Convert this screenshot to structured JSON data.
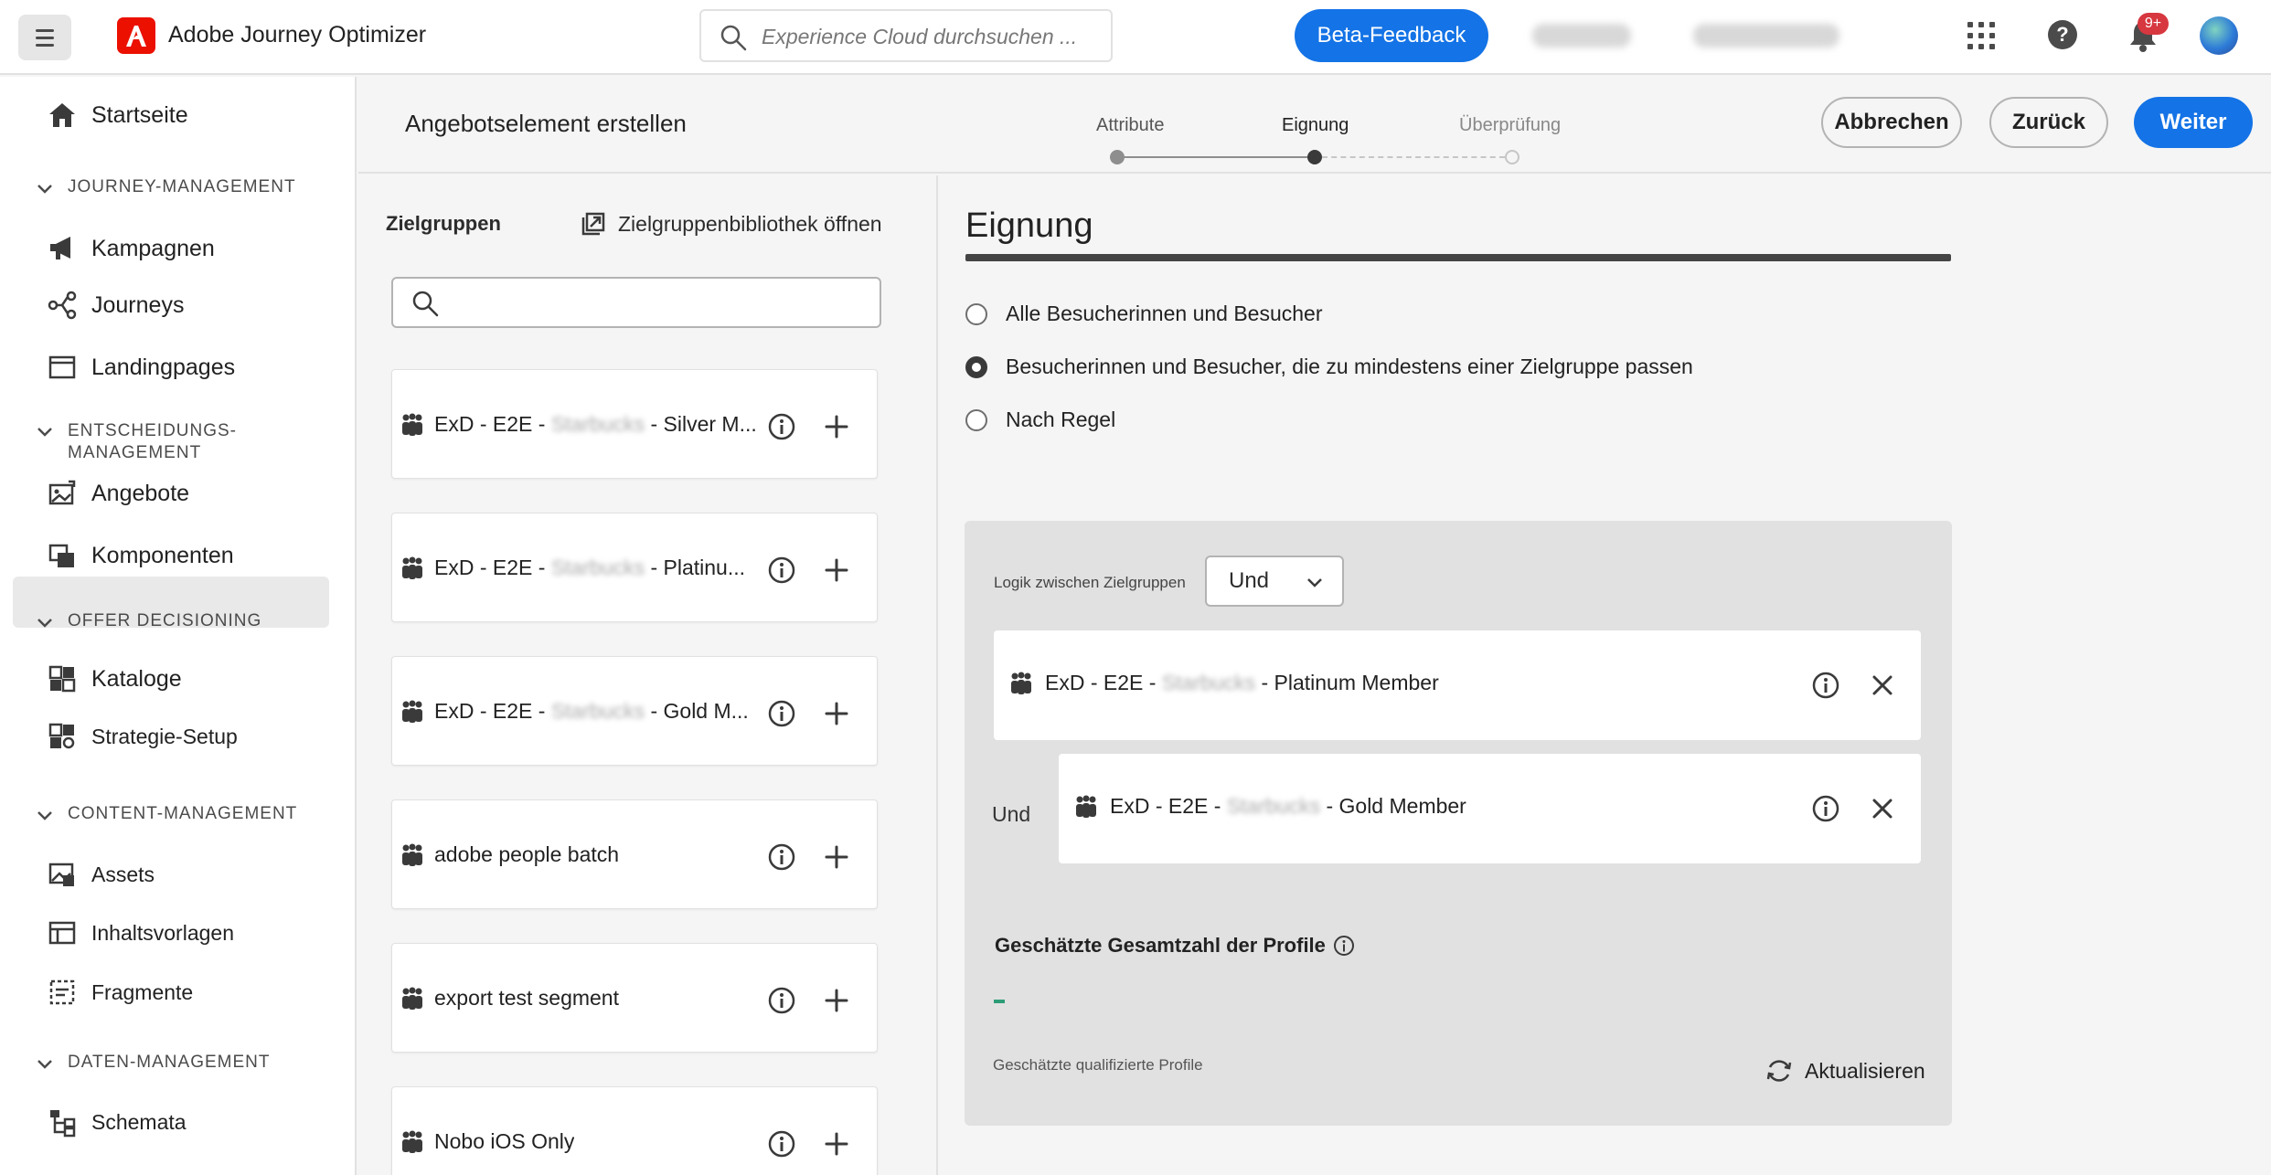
{
  "topbar": {
    "app_name": "Adobe Journey Optimizer",
    "search_placeholder": "Experience Cloud durchsuchen ...",
    "beta_feedback": "Beta-Feedback",
    "notifications_badge": "9+"
  },
  "sidebar": {
    "home": "Startseite",
    "sections": [
      {
        "label": "JOURNEY-MANAGEMENT",
        "items": [
          "Kampagnen",
          "Journeys",
          "Landingpages"
        ]
      },
      {
        "label": "ENTSCHEIDUNGS-\nMANAGEMENT",
        "items": [
          "Angebote",
          "Komponenten"
        ]
      },
      {
        "label": "OFFER DECISIONING",
        "items": [
          "Kataloge",
          "Strategie-Setup"
        ]
      },
      {
        "label": "CONTENT-MANAGEMENT",
        "items": [
          "Assets",
          "Inhaltsvorlagen",
          "Fragmente"
        ]
      },
      {
        "label": "DATEN-MANAGEMENT",
        "items": [
          "Schemata"
        ]
      }
    ],
    "active_item": "Kataloge"
  },
  "header": {
    "page_title": "Angebotselement erstellen",
    "steps": [
      {
        "label": "Attribute",
        "state": "done"
      },
      {
        "label": "Eignung",
        "state": "current"
      },
      {
        "label": "Überprüfung",
        "state": "todo"
      }
    ],
    "cancel": "Abbrechen",
    "back": "Zurück",
    "next": "Weiter"
  },
  "audiences": {
    "heading": "Zielgruppen",
    "library_link": "Zielgruppenbibliothek öffnen",
    "search_value": "",
    "list": [
      {
        "prefix": "ExD - E2E - ",
        "blurred": "Starbucks",
        "suffix": " - Silver M..."
      },
      {
        "prefix": "ExD - E2E - ",
        "blurred": "Starbucks",
        "suffix": " - Platinu..."
      },
      {
        "prefix": "ExD - E2E - ",
        "blurred": "Starbucks",
        "suffix": " - Gold M..."
      },
      {
        "prefix": "adobe people batch",
        "blurred": "",
        "suffix": ""
      },
      {
        "prefix": "export test segment",
        "blurred": "",
        "suffix": ""
      },
      {
        "prefix": "Nobo iOS Only",
        "blurred": "",
        "suffix": ""
      }
    ]
  },
  "eligibility": {
    "title": "Eignung",
    "options": [
      {
        "label": "Alle Besucherinnen und Besucher",
        "selected": false
      },
      {
        "label": "Besucherinnen und Besucher, die zu mindestens einer Zielgruppe passen",
        "selected": true
      },
      {
        "label": "Nach Regel",
        "selected": false
      }
    ],
    "logic_label": "Logik zwischen Zielgruppen",
    "logic_value": "Und",
    "selected_audiences": [
      {
        "prefix": "ExD - E2E - ",
        "blurred": "Starbucks",
        "suffix": " - Platinum Member"
      },
      {
        "prefix": "ExD - E2E - ",
        "blurred": "Starbucks",
        "suffix": " - Gold Member"
      }
    ],
    "connector": "Und",
    "estimate_title": "Geschätzte Gesamtzahl der Profile",
    "estimate_value": "–",
    "estimate_sub": "Geschätzte qualifizierte Profile",
    "refresh": "Aktualisieren"
  },
  "colors": {
    "accent": "#1473e6",
    "badge": "#d7373f",
    "brand": "#eb1000",
    "estimate": "#2d9d78"
  }
}
